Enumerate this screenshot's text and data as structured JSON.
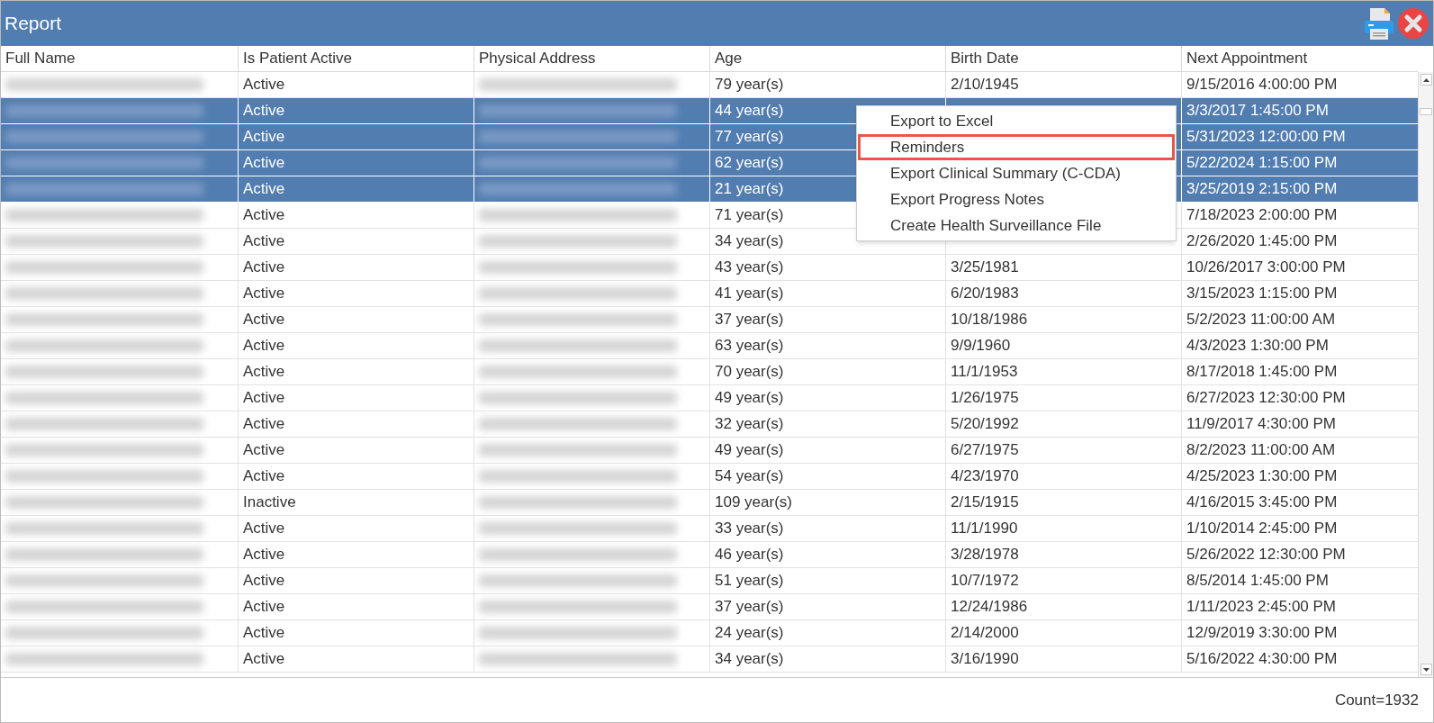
{
  "window": {
    "title": "Report"
  },
  "table": {
    "columns": [
      "Full Name",
      "Is Patient Active",
      "Physical Address",
      "Age",
      "Birth Date",
      "Next Appointment"
    ],
    "rows": [
      {
        "selected": false,
        "name_blurred": true,
        "active": "Active",
        "address_blurred": true,
        "age": "79 year(s)",
        "birth_date": "2/10/1945",
        "next": "9/15/2016 4:00:00 PM"
      },
      {
        "selected": true,
        "name_blurred": true,
        "active": "Active",
        "address_blurred": true,
        "age": "44 year(s)",
        "next": "3/3/2017 1:45:00 PM"
      },
      {
        "selected": true,
        "name_blurred": true,
        "active": "Active",
        "address_blurred": true,
        "age": "77 year(s)",
        "next": "5/31/2023 12:00:00 PM"
      },
      {
        "selected": true,
        "name_blurred": true,
        "active": "Active",
        "address_blurred": true,
        "age": "62 year(s)",
        "next": "5/22/2024 1:15:00 PM"
      },
      {
        "selected": true,
        "name_blurred": true,
        "active": "Active",
        "address_blurred": true,
        "age": "21 year(s)",
        "next": "3/25/2019 2:15:00 PM"
      },
      {
        "selected": false,
        "name_blurred": true,
        "active": "Active",
        "address_blurred": true,
        "age": "71 year(s)",
        "next": "7/18/2023 2:00:00 PM"
      },
      {
        "selected": false,
        "name_blurred": true,
        "active": "Active",
        "address_blurred": true,
        "age": "34 year(s)",
        "next": "2/26/2020 1:45:00 PM"
      },
      {
        "selected": false,
        "name_blurred": true,
        "active": "Active",
        "address_blurred": true,
        "age": "43 year(s)",
        "birth_date": "3/25/1981",
        "next": "10/26/2017 3:00:00 PM"
      },
      {
        "selected": false,
        "name_blurred": true,
        "active": "Active",
        "address_blurred": true,
        "age": "41 year(s)",
        "birth_date": "6/20/1983",
        "next": "3/15/2023 1:15:00 PM"
      },
      {
        "selected": false,
        "name_blurred": true,
        "active": "Active",
        "address_blurred": true,
        "age": "37 year(s)",
        "birth_date": "10/18/1986",
        "next": "5/2/2023 11:00:00 AM"
      },
      {
        "selected": false,
        "name_blurred": true,
        "active": "Active",
        "address_blurred": true,
        "age": "63 year(s)",
        "birth_date": "9/9/1960",
        "next": "4/3/2023 1:30:00 PM"
      },
      {
        "selected": false,
        "name_blurred": true,
        "active": "Active",
        "address_blurred": true,
        "age": "70 year(s)",
        "birth_date": "11/1/1953",
        "next": "8/17/2018 1:45:00 PM"
      },
      {
        "selected": false,
        "name_blurred": true,
        "active": "Active",
        "address_blurred": true,
        "age": "49 year(s)",
        "birth_date": "1/26/1975",
        "next": "6/27/2023 12:30:00 PM"
      },
      {
        "selected": false,
        "name_blurred": true,
        "active": "Active",
        "address_blurred": true,
        "age": "32 year(s)",
        "birth_date": "5/20/1992",
        "next": "11/9/2017 4:30:00 PM"
      },
      {
        "selected": false,
        "name_blurred": true,
        "active": "Active",
        "address_blurred": true,
        "age": "49 year(s)",
        "birth_date": "6/27/1975",
        "next": "8/2/2023 11:00:00 AM"
      },
      {
        "selected": false,
        "name_blurred": true,
        "active": "Active",
        "address_blurred": true,
        "age": "54 year(s)",
        "birth_date": "4/23/1970",
        "next": "4/25/2023 1:30:00 PM"
      },
      {
        "selected": false,
        "name_blurred": true,
        "active": "Inactive",
        "address_blurred": true,
        "age": "109 year(s)",
        "birth_date": "2/15/1915",
        "next": "4/16/2015 3:45:00 PM"
      },
      {
        "selected": false,
        "name_blurred": true,
        "active": "Active",
        "address_blurred": true,
        "age": "33 year(s)",
        "birth_date": "11/1/1990",
        "next": "1/10/2014 2:45:00 PM"
      },
      {
        "selected": false,
        "name_blurred": true,
        "active": "Active",
        "address_blurred": true,
        "age": "46 year(s)",
        "birth_date": "3/28/1978",
        "next": "5/26/2022 12:30:00 PM"
      },
      {
        "selected": false,
        "name_blurred": true,
        "active": "Active",
        "address_blurred": true,
        "age": "51 year(s)",
        "birth_date": "10/7/1972",
        "next": "8/5/2014 1:45:00 PM"
      },
      {
        "selected": false,
        "name_blurred": true,
        "active": "Active",
        "address_blurred": true,
        "age": "37 year(s)",
        "birth_date": "12/24/1986",
        "next": "1/11/2023 2:45:00 PM"
      },
      {
        "selected": false,
        "name_blurred": true,
        "active": "Active",
        "address_blurred": true,
        "age": "24 year(s)",
        "birth_date": "2/14/2000",
        "next": "12/9/2019 3:30:00 PM"
      },
      {
        "selected": false,
        "name_blurred": true,
        "active": "Active",
        "address_blurred": true,
        "age": "34 year(s)",
        "birth_date": "3/16/1990",
        "next": "5/16/2022 4:30:00 PM"
      }
    ]
  },
  "context_menu": {
    "items": [
      {
        "label": "Export to Excel",
        "selected": false
      },
      {
        "label": "Reminders",
        "selected": true
      },
      {
        "label": "Export Clinical Summary (C-CDA)",
        "selected": false
      },
      {
        "label": "Export Progress Notes",
        "selected": false
      },
      {
        "label": "Create Health Surveillance File",
        "selected": false
      }
    ]
  },
  "status_bar": {
    "count": "Count=1932"
  }
}
